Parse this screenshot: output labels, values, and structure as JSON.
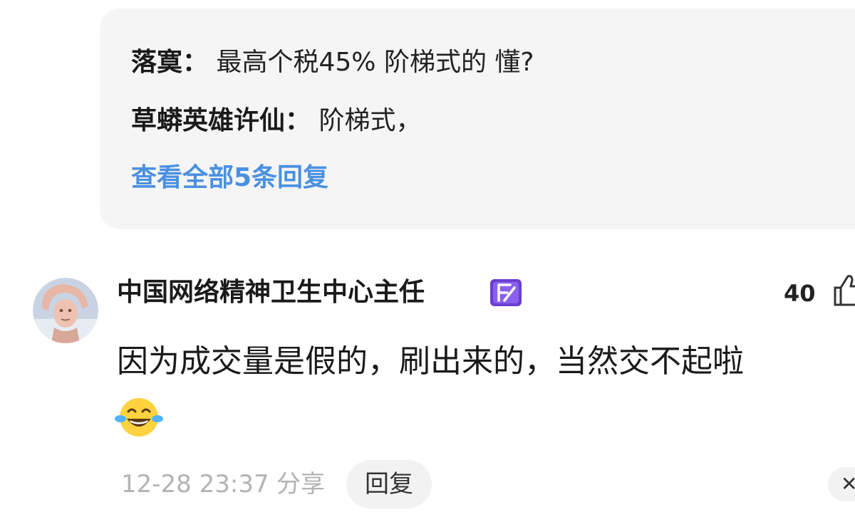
{
  "reply_preview": {
    "replies": [
      {
        "author": "落寞",
        "colon": "：",
        "text": "最高个税45% 阶梯式的 懂?"
      },
      {
        "author": "草蟒英雄许仙",
        "colon": "：",
        "text": "阶梯式，"
      }
    ],
    "view_all_label": "查看全部5条回复"
  },
  "comment": {
    "username": "中国网络精神卫生中心主任",
    "badge_icon": "level-badge-icon",
    "likes": "40",
    "like_icon": "thumbs-up-icon",
    "text": "因为成交量是假的，刷出来的，当然交不起啦",
    "emoji": "laughing-tears-emoji",
    "timestamp": "12-28 23:37",
    "share_label": "分享",
    "reply_label": "回复"
  },
  "colors": {
    "link": "#4a90e2",
    "muted": "#b3b3b3",
    "badge": "#6a3fd0"
  }
}
